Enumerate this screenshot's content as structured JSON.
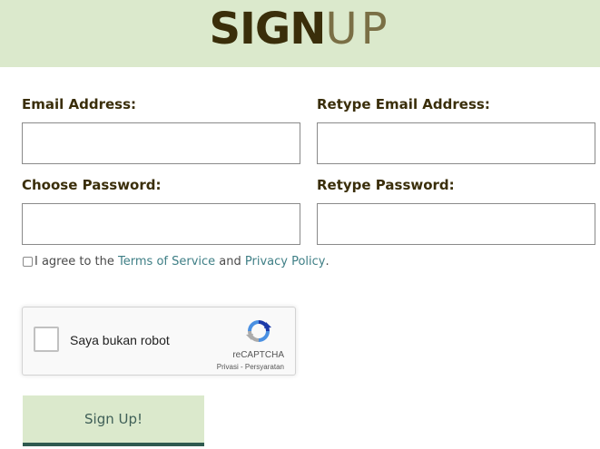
{
  "header": {
    "title_bold": "SIGN",
    "title_light": "UP",
    "background": "#dbe9cc"
  },
  "form": {
    "email_label": "Email Address:",
    "retype_email_label": "Retype Email Address:",
    "password_label": "Choose Password:",
    "retype_password_label": "Retype Password:",
    "email_value": "",
    "retype_email_value": "",
    "password_value": "",
    "retype_password_value": "",
    "agree": {
      "prefix": "I agree to the ",
      "terms_link": "Terms of Service",
      "middle": " and ",
      "privacy_link": "Privacy Policy",
      "suffix": ".",
      "checked": false
    },
    "submit_label": "Sign Up!"
  },
  "recaptcha": {
    "label": "Saya bukan robot",
    "brand": "reCAPTCHA",
    "privacy": "Privasi",
    "separator": " - ",
    "terms": "Persyaratan",
    "icon": "recaptcha-logo-icon"
  },
  "colors": {
    "title_dark": "#3a2e0a",
    "link": "#3f7f86",
    "button_border": "#2f5a4f"
  }
}
